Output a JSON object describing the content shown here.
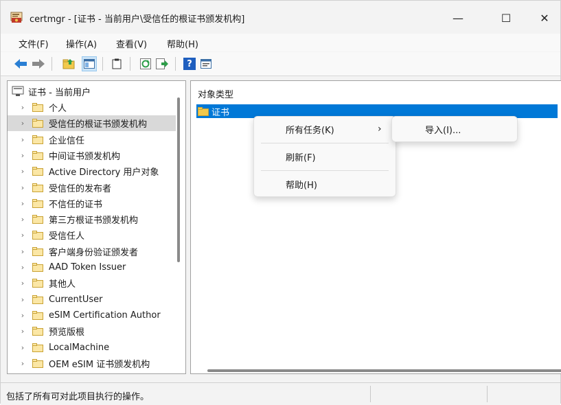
{
  "window": {
    "title": "certmgr - [证书 - 当前用户\\受信任的根证书颁发机构]",
    "minimize": "—",
    "maximize": "☐",
    "close": "✕"
  },
  "menu": {
    "items": [
      "文件(F)",
      "操作(A)",
      "查看(V)",
      "帮助(H)"
    ]
  },
  "toolbar": {
    "icons": [
      "back-arrow-icon",
      "forward-arrow-icon",
      "up-folder-icon",
      "show-hide-tree-icon",
      "clipboard-icon",
      "refresh-icon",
      "export-list-icon",
      "help-icon",
      "properties-icon"
    ],
    "help_glyph": "?"
  },
  "tree": {
    "root": "证书 - 当前用户",
    "items": [
      {
        "label": "个人"
      },
      {
        "label": "受信任的根证书颁发机构"
      },
      {
        "label": "企业信任"
      },
      {
        "label": "中间证书颁发机构"
      },
      {
        "label": "Active Directory 用户对象"
      },
      {
        "label": "受信任的发布者"
      },
      {
        "label": "不信任的证书"
      },
      {
        "label": "第三方根证书颁发机构"
      },
      {
        "label": "受信任人"
      },
      {
        "label": "客户端身份验证颁发者"
      },
      {
        "label": "AAD Token Issuer"
      },
      {
        "label": "其他人"
      },
      {
        "label": "CurrentUser"
      },
      {
        "label": "eSIM Certification Author"
      },
      {
        "label": "预览版根"
      },
      {
        "label": "LocalMachine"
      },
      {
        "label": "OEM eSIM 证书颁发机构"
      }
    ],
    "selected_index": 1,
    "chevron": "›"
  },
  "content": {
    "column_header": "对象类型",
    "rows": [
      {
        "label": "证书"
      }
    ]
  },
  "context_menu": {
    "items": [
      {
        "label": "所有任务(K)",
        "has_submenu": true
      },
      {
        "label": "刷新(F)"
      },
      {
        "label": "帮助(H)"
      }
    ],
    "submenu_arrow": "›",
    "submenu": {
      "items": [
        {
          "label": "导入(I)..."
        }
      ]
    }
  },
  "status": {
    "text": "包括了所有可对此项目执行的操作。"
  },
  "colors": {
    "selection_blue": "#0078d7",
    "folder_yellow": "#f2c94c"
  }
}
